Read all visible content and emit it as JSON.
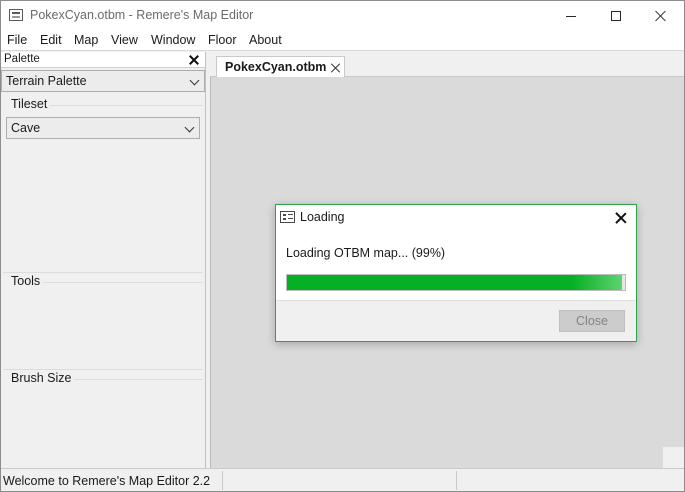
{
  "window": {
    "title": "PokexCyan.otbm - Remere's Map Editor",
    "icon": "app-icon"
  },
  "menubar": {
    "items": [
      "File",
      "Edit",
      "Map",
      "View",
      "Window",
      "Floor",
      "About"
    ]
  },
  "palette": {
    "title": "Palette",
    "palette_type": "Terrain Palette",
    "tileset_label": "Tileset",
    "tileset_value": "Cave",
    "tools_label": "Tools",
    "brush_size_label": "Brush Size"
  },
  "tabs": [
    {
      "label": "PokexCyan.otbm",
      "active": true
    }
  ],
  "dialog": {
    "title": "Loading",
    "message": "Loading OTBM map... (99%)",
    "progress": 0.99,
    "progress_color": "#06b025",
    "close_button": "Close",
    "close_enabled": false
  },
  "statusbar": {
    "text": "Welcome to Remere's Map Editor 2.2"
  }
}
